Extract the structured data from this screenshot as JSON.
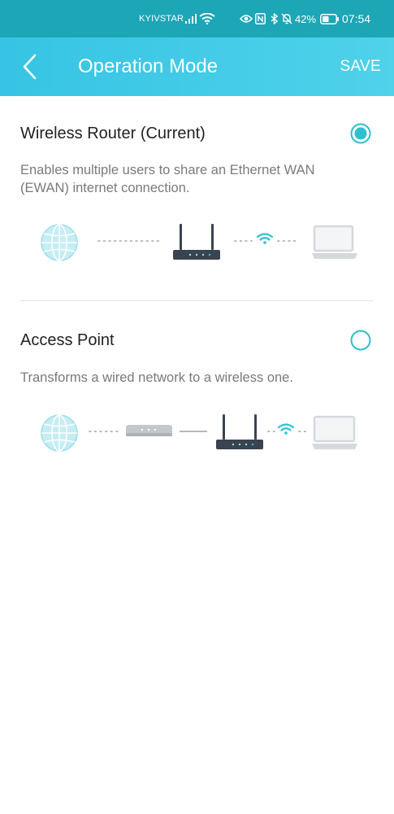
{
  "status_bar": {
    "carrier": "KYIVSTAR",
    "battery_percent": "42%",
    "time": "07:54",
    "icons": [
      "signal-icon",
      "wifi-icon",
      "eye-icon",
      "nfc-icon",
      "bluetooth-icon",
      "bell-off-icon",
      "battery-icon"
    ]
  },
  "header": {
    "title": "Operation Mode",
    "save_label": "SAVE",
    "back_icon": "back-chevron-icon"
  },
  "modes": [
    {
      "title": "Wireless Router (Current)",
      "description": "Enables multiple users to share an Ethernet WAN (EWAN) internet connection.",
      "selected": true
    },
    {
      "title": "Access Point",
      "description": "Transforms a wired network to a wireless one.",
      "selected": false
    }
  ],
  "colors": {
    "header_gradient_start": "#36c4e4",
    "header_gradient_end": "#4fd2ea",
    "status_bar": "#1ca6b6",
    "accent": "#2fbfcf",
    "globe": "#c5edf4",
    "router_body": "#3b4350",
    "laptop": "#d5d8dc"
  }
}
